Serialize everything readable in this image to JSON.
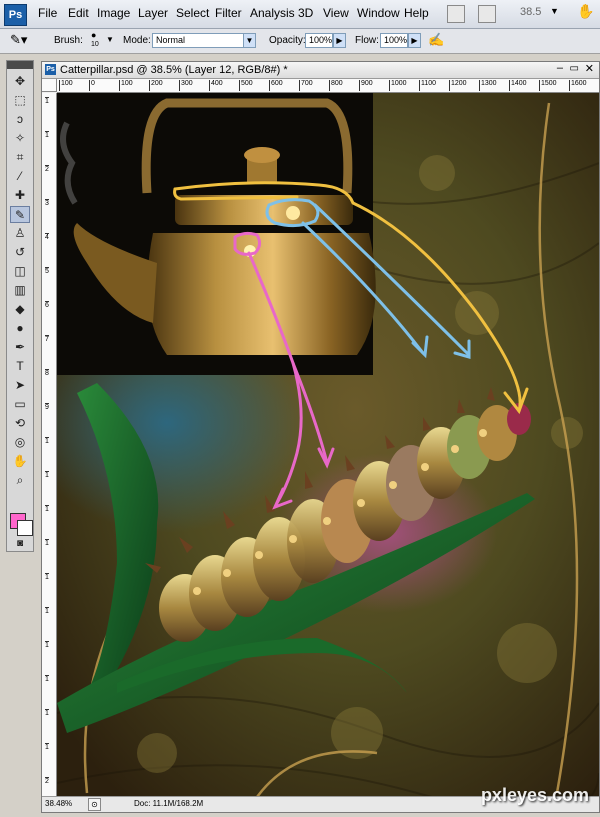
{
  "app": {
    "logo": "Ps"
  },
  "menu": [
    "File",
    "Edit",
    "Image",
    "Layer",
    "Select",
    "Filter",
    "Analysis",
    "3D",
    "View",
    "Window",
    "Help"
  ],
  "topbar": {
    "zoom": "38.5"
  },
  "options": {
    "brush_label": "Brush:",
    "brush_size": "10",
    "mode_label": "Mode:",
    "mode_value": "Normal",
    "opacity_label": "Opacity:",
    "opacity_value": "100%",
    "flow_label": "Flow:",
    "flow_value": "100%"
  },
  "tools": [
    {
      "name": "move-tool",
      "glyph": "✥"
    },
    {
      "name": "marquee-tool",
      "glyph": "⬚"
    },
    {
      "name": "lasso-tool",
      "glyph": "ↄ"
    },
    {
      "name": "magic-wand-tool",
      "glyph": "✧"
    },
    {
      "name": "crop-tool",
      "glyph": "⌗"
    },
    {
      "name": "eyedropper-tool",
      "glyph": "⁄"
    },
    {
      "name": "healing-brush-tool",
      "glyph": "✚"
    },
    {
      "name": "brush-tool",
      "glyph": "✎"
    },
    {
      "name": "clone-stamp-tool",
      "glyph": "♙"
    },
    {
      "name": "history-brush-tool",
      "glyph": "↺"
    },
    {
      "name": "eraser-tool",
      "glyph": "◫"
    },
    {
      "name": "gradient-tool",
      "glyph": "▥"
    },
    {
      "name": "blur-tool",
      "glyph": "◆"
    },
    {
      "name": "dodge-tool",
      "glyph": "●"
    },
    {
      "name": "pen-tool",
      "glyph": "✒"
    },
    {
      "name": "type-tool",
      "glyph": "T"
    },
    {
      "name": "path-selection-tool",
      "glyph": "➤"
    },
    {
      "name": "shape-tool",
      "glyph": "▭"
    },
    {
      "name": "3d-rotate-tool",
      "glyph": "⟲"
    },
    {
      "name": "3d-orbit-tool",
      "glyph": "◎"
    },
    {
      "name": "hand-tool",
      "glyph": "✋"
    },
    {
      "name": "zoom-tool",
      "glyph": "⌕"
    }
  ],
  "document": {
    "title": "Catterpillar.psd @ 38.5% (Layer 12, RGB/8#) *",
    "ruler_h": [
      "100",
      "0",
      "100",
      "200",
      "300",
      "400",
      "500",
      "600",
      "700",
      "800",
      "900",
      "1000",
      "1100",
      "1200",
      "1300",
      "1400",
      "1500",
      "1600"
    ],
    "ruler_v": [
      "1",
      "1",
      "2",
      "3",
      "4",
      "5",
      "6",
      "7",
      "8",
      "9",
      "1",
      "1",
      "1",
      "1",
      "1",
      "1",
      "1",
      "1",
      "1",
      "1",
      "2"
    ],
    "status_zoom": "38.48%",
    "status_doc": "Doc: 11.1M/168.2M",
    "watermark": "pxleyes.com"
  },
  "colors": {
    "foreground": "#ff66cc",
    "background": "#ffffff",
    "accent": "#1b5fa8"
  }
}
